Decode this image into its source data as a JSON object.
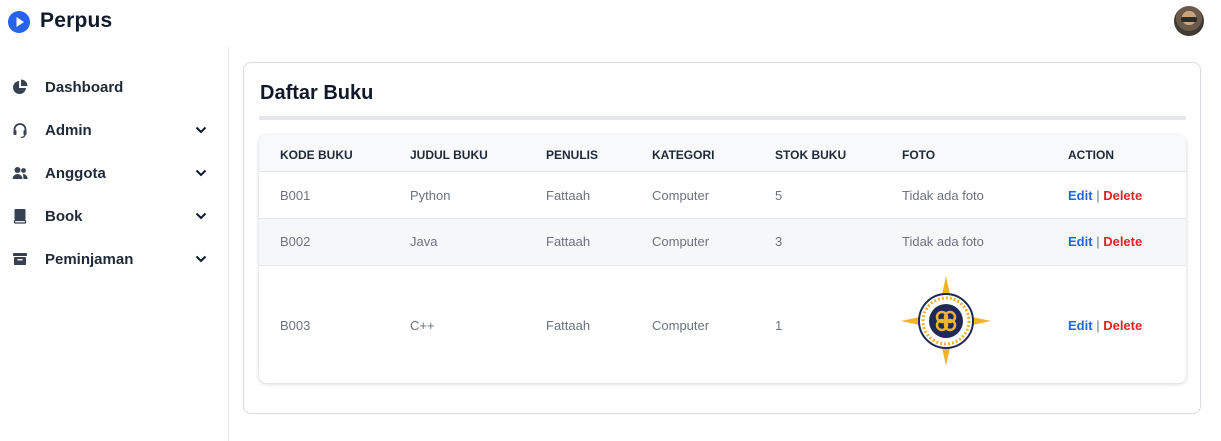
{
  "app": {
    "brand": "Perpus"
  },
  "sidebar": {
    "items": [
      {
        "label": "Dashboard",
        "icon": "pie-chart-icon"
      },
      {
        "label": "Admin",
        "icon": "headset-icon"
      },
      {
        "label": "Anggota",
        "icon": "users-icon"
      },
      {
        "label": "Book",
        "icon": "book-icon"
      },
      {
        "label": "Peminjaman",
        "icon": "inbox-icon"
      }
    ]
  },
  "main": {
    "title": "Daftar Buku",
    "table": {
      "columns": [
        "KODE BUKU",
        "JUDUL BUKU",
        "PENULIS",
        "KATEGORI",
        "STOK BUKU",
        "FOTO",
        "ACTION"
      ],
      "rows": [
        {
          "kode": "B001",
          "judul": "Python",
          "penulis": "Fattaah",
          "kategori": "Computer",
          "stok": "5",
          "foto": "Tidak ada foto",
          "edit": "Edit",
          "sep": "|",
          "delete": "Delete"
        },
        {
          "kode": "B002",
          "judul": "Java",
          "penulis": "Fattaah",
          "kategori": "Computer",
          "stok": "3",
          "foto": "Tidak ada foto",
          "edit": "Edit",
          "sep": "|",
          "delete": "Delete"
        },
        {
          "kode": "B003",
          "judul": "C++",
          "penulis": "Fattaah",
          "kategori": "Computer",
          "stok": "1",
          "foto": "",
          "edit": "Edit",
          "sep": "|",
          "delete": "Delete"
        }
      ]
    }
  },
  "colors": {
    "accent": "#2563eb",
    "danger": "#dc2626",
    "seal_gold": "#f0b429",
    "seal_navy": "#1e2a55"
  }
}
